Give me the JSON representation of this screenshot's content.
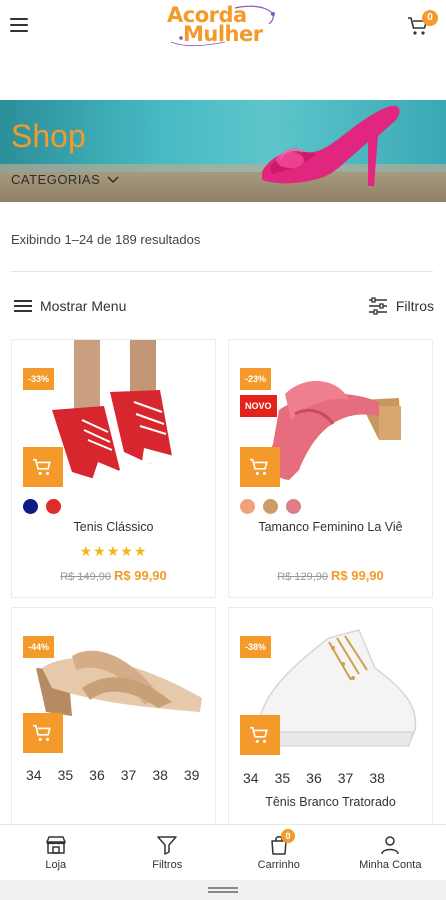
{
  "header": {
    "logo_line1": "Acorda",
    "logo_line2": "Mulher",
    "cart_count": "0"
  },
  "banner": {
    "title": "Shop",
    "categories_label": "CATEGORIAS"
  },
  "results_text": "Exibindo 1–24 de 189 resultados",
  "toolbar": {
    "menu_label": "Mostrar Menu",
    "filter_label": "Filtros"
  },
  "products": [
    {
      "discount": "-33%",
      "name": "Tenis Clássico",
      "old_price": "R$ 149,90",
      "price": "R$ 99,90",
      "swatches": [
        "#0d1a87",
        "#e12a2a"
      ],
      "rating_stars": "★★★★★"
    },
    {
      "discount": "-23%",
      "new_label": "NOVO",
      "name": "Tamanco Feminino La Viê",
      "old_price": "R$ 129,90",
      "price": "R$ 99,90",
      "swatches": [
        "#f0a27b",
        "#cf9b6c",
        "#e07d8a"
      ]
    },
    {
      "discount": "-44%",
      "sizes": [
        "34",
        "35",
        "36",
        "37",
        "38",
        "39"
      ]
    },
    {
      "discount": "-38%",
      "sizes": [
        "34",
        "35",
        "36",
        "37",
        "38"
      ],
      "name": "Tênis Branco Tratorado"
    }
  ],
  "bottom_nav": {
    "loja": "Loja",
    "filtros": "Filtros",
    "carrinho": "Carrinho",
    "carrinho_count": "0",
    "conta": "Minha Conta"
  },
  "colors": {
    "accent": "#f39a2b",
    "new_badge": "#e32219",
    "star": "#f3b51c"
  }
}
